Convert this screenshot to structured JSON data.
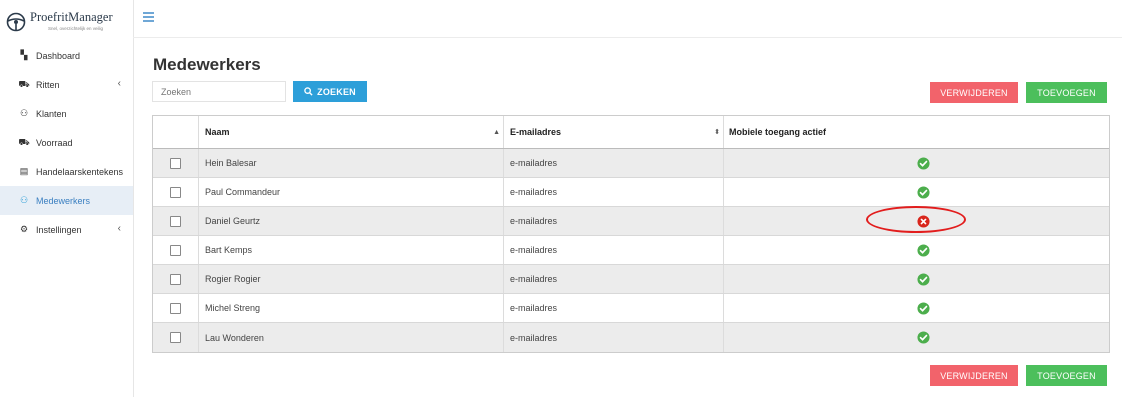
{
  "brand": {
    "name": "ProefritManager",
    "tagline": "Snel, overzichtelijk en veilig"
  },
  "sidebar": {
    "items": [
      {
        "label": "Dashboard",
        "icon": "dashboard-icon",
        "glyph": "▚",
        "has_chevron": false,
        "active": false
      },
      {
        "label": "Ritten",
        "icon": "car-icon",
        "glyph": "⛟",
        "has_chevron": true,
        "active": false
      },
      {
        "label": "Klanten",
        "icon": "users-icon",
        "glyph": "⚇",
        "has_chevron": false,
        "active": false
      },
      {
        "label": "Voorraad",
        "icon": "stock-car-icon",
        "glyph": "⛟",
        "has_chevron": false,
        "active": false
      },
      {
        "label": "Handelaarskentekens",
        "icon": "license-plate-icon",
        "glyph": "▤",
        "has_chevron": false,
        "active": false
      },
      {
        "label": "Medewerkers",
        "icon": "employees-icon",
        "glyph": "⚇",
        "has_chevron": false,
        "active": true
      },
      {
        "label": "Instellingen",
        "icon": "gear-icon",
        "glyph": "⚙",
        "has_chevron": true,
        "active": false
      }
    ],
    "chevron": "‹"
  },
  "page": {
    "title": "Medewerkers",
    "search_placeholder": "Zoeken",
    "search_button": "ZOEKEN",
    "delete_button": "VERWIJDEREN",
    "add_button": "TOEVOEGEN"
  },
  "table": {
    "columns": {
      "name": "Naam",
      "email": "E-mailadres",
      "mobile": "Mobiele toegang actief"
    },
    "rows": [
      {
        "name": "Hein Balesar",
        "email": "e-mailadres",
        "mobile_active": true
      },
      {
        "name": "Paul Commandeur",
        "email": "e-mailadres",
        "mobile_active": true
      },
      {
        "name": "Daniel Geurtz",
        "email": "e-mailadres",
        "mobile_active": false
      },
      {
        "name": "Bart Kemps",
        "email": "e-mailadres",
        "mobile_active": true
      },
      {
        "name": "Rogier Rogier",
        "email": "e-mailadres",
        "mobile_active": true
      },
      {
        "name": "Michel Streng",
        "email": "e-mailadres",
        "mobile_active": true
      },
      {
        "name": "Lau Wonderen",
        "email": "e-mailadres",
        "mobile_active": true
      }
    ]
  },
  "colors": {
    "accent": "#2d9fd9",
    "danger": "#f2636b",
    "success": "#4cbf5c",
    "status_ok": "#4cae4c",
    "status_error": "#d9261c",
    "highlight_ellipse": "#e21d1d"
  }
}
